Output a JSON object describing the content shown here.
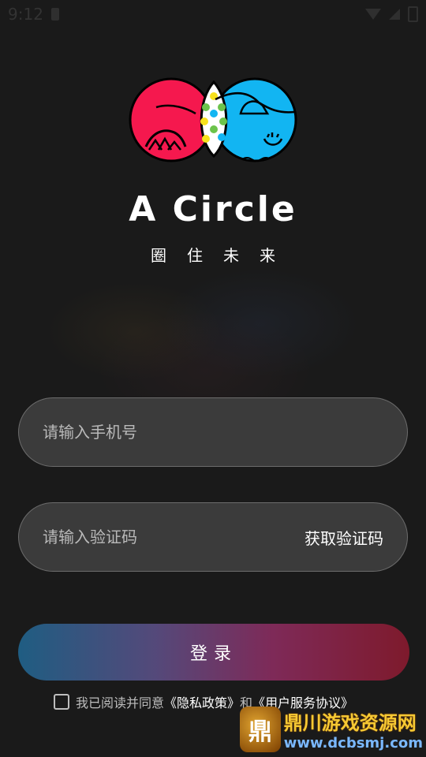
{
  "status_bar": {
    "time": "9:12"
  },
  "app": {
    "title": "A Circle",
    "slogan": "圈住未来"
  },
  "login_form": {
    "phone_placeholder": "请输入手机号",
    "code_placeholder": "请输入验证码",
    "get_code_label": "获取验证码",
    "login_label": "登录"
  },
  "agreement": {
    "prefix": "我已阅读并同意",
    "privacy_label": "《隐私政策》",
    "and": "和",
    "terms_label": "《用户服务协议》"
  },
  "watermark": {
    "badge": "鼎",
    "title": "鼎川游戏资源网",
    "url": "www.dcbsmj.com"
  },
  "colors": {
    "logo_red": "#f5184e",
    "logo_blue": "#12b5f2",
    "logo_green": "#6cc34b",
    "logo_yellow": "#f7e11c",
    "login_gradient_start": "#1f5d82",
    "login_gradient_end": "#7e1a2c"
  }
}
